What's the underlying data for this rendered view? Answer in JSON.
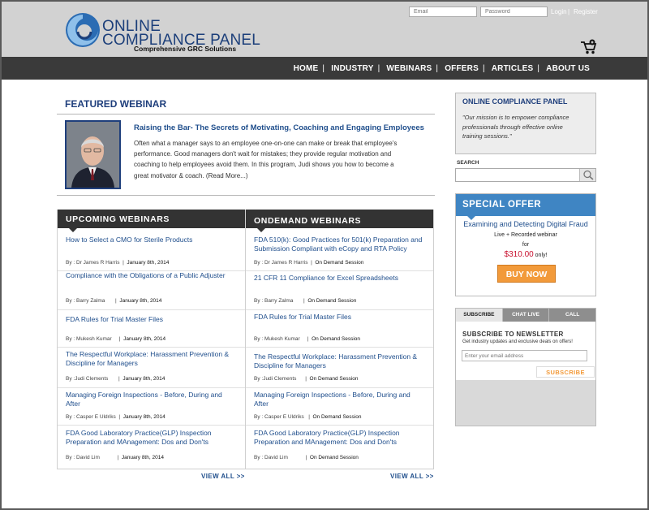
{
  "header": {
    "logo_line1": "ONLINE",
    "logo_line2": "COMPLIANCE PANEL",
    "logo_tagline": "Comprehensive GRC Solutions",
    "email_placeholder": "Email",
    "password_placeholder": "Password",
    "login_label": "Login",
    "divider": "|",
    "register_label": "Register",
    "cart_icon": "shopping-cart-icon"
  },
  "nav": {
    "items": [
      "HOME",
      "INDUSTRY",
      "WEBINARS",
      "OFFERS",
      "ARTICLES",
      "ABOUT US"
    ],
    "separator": "|"
  },
  "featured": {
    "section_title": "FEATURED WEBINAR",
    "headline": "Raising the Bar- The Secrets of Motivating, Coaching and Engaging Employees",
    "description": "Often what a manager says to an employee one-on-one can make or break that employee's performance. Good managers don't wait for mistakes; they provide regular motivation and coaching to help employees avoid them. In this program, Judi shows you how to become a great motivator & coach. (Read More...)"
  },
  "upcoming": {
    "header": "UPCOMING  WEBINARS",
    "view_all": "VIEW ALL  >>",
    "items": [
      {
        "title": "How to Select a CMO for Sterile Products",
        "by": "By : Dr James R Harris",
        "date": "January 8th, 2014"
      },
      {
        "title": "Compliance with the Obligations of a Public Adjuster",
        "by": "By : Barry Zalma",
        "date": "January 8th, 2014"
      },
      {
        "title": "FDA Rules for Trial Master Files",
        "by": "By : Mukesh Kumar",
        "date": "January 8th, 2014"
      },
      {
        "title": "The Respectful Workplace: Harassment Prevention & Discipline for Managers",
        "by": "By :Judi Clements",
        "date": "January 8th, 2014"
      },
      {
        "title": "Managing Foreign Inspections - Before, During and After",
        "by": "By : Casper E Uldriks",
        "date": "January 8th, 2014"
      },
      {
        "title": "FDA Good Laboratory Practice(GLP) Inspection Preparation and MAnagement: Dos and Don'ts",
        "by": "By : David Lim",
        "date": "January 8th, 2014"
      }
    ]
  },
  "ondemand": {
    "header": "ONDEMAND  WEBINARS",
    "view_all": "VIEW ALL  >>",
    "items": [
      {
        "title": "FDA 510(k): Good Practices for 501(k) Preparation and Submission Compliant with eCopy and RTA Policy",
        "by": "By : Dr James R Harris",
        "date": "On Demand Session"
      },
      {
        "title": "21 CFR 11 Compliance for Excel Spreadsheets",
        "by": "By : Barry Zalma",
        "date": "On Demand Session"
      },
      {
        "title": "FDA Rules for Trial Master Files",
        "by": "By : Mukesh Kumar",
        "date": "On Demand Session"
      },
      {
        "title": "The Respectful Workplace: Harassment Prevention & Discipline for Managers",
        "by": "By :Judi Clements",
        "date": "On Demand Session"
      },
      {
        "title": "Managing Foreign Inspections - Before, During and After",
        "by": "By : Casper E Uldriks",
        "date": "On Demand Session"
      },
      {
        "title": "FDA Good Laboratory Practice(GLP) Inspection Preparation and MAnagement: Dos and Don'ts",
        "by": "By : David Lim",
        "date": "On Demand Session"
      }
    ]
  },
  "sidebar": {
    "ocp_title": "ONLINE COMPLIANCE PANEL",
    "ocp_mission": "\"Our mission is to empower compliance professionals through effective online training sessions.\"",
    "search_label": "SEARCH",
    "search_icon": "magnifier-icon",
    "offer_header": "SPECIAL OFFER",
    "offer_title": "Examining and Detecting Digital Fraud",
    "offer_sub": "Live + Recorded webinar",
    "offer_for": "for",
    "offer_price": "$310.00",
    "offer_only": "only!",
    "buy_label": "BUY NOW",
    "tabs": [
      "SUBSCRIBE",
      "CHAT LIVE",
      "CALL"
    ],
    "newsletter_title": "SUBSCRIBE TO NEWSLETTER",
    "newsletter_text": "Get industry updates and exclusive deals on offers!",
    "newsletter_placeholder": "Enter your email address",
    "subscribe_label": "SUBSCRIBE"
  },
  "colors": {
    "brand_blue": "#1f3f7c",
    "link_blue": "#1f4e8c",
    "nav_bg": "#3a3a3a",
    "offer_blue": "#3f85c3",
    "button_orange": "#f29a3a",
    "price_red": "#c8102e"
  }
}
